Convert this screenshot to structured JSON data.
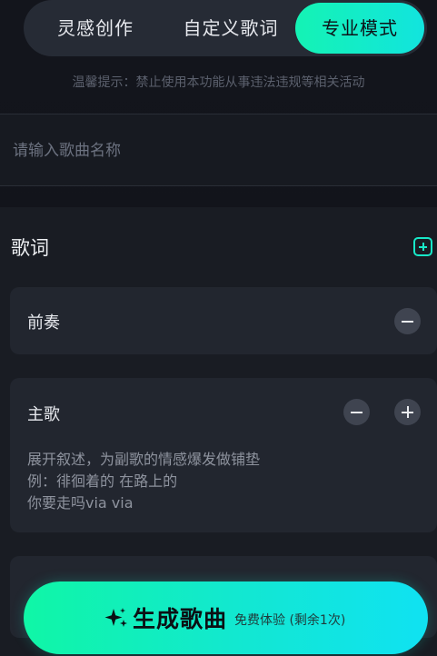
{
  "tabs": [
    {
      "label": "灵感创作",
      "active": false
    },
    {
      "label": "自定义歌词",
      "active": false
    },
    {
      "label": "专业模式",
      "active": true
    }
  ],
  "notice": "温馨提示：禁止使用本功能从事违法违规等相关活动",
  "song_name": {
    "value": "",
    "placeholder": "请输入歌曲名称"
  },
  "lyrics": {
    "title": "歌词",
    "sections": [
      {
        "title": "前奏"
      },
      {
        "title": "主歌",
        "hint_lines": [
          "展开叙述，为副歌的情感爆发做铺垫",
          "例：徘徊着的 在路上的",
          "你要走吗via via"
        ]
      }
    ]
  },
  "generate": {
    "label": "生成歌曲",
    "sub": "免费体验 (剩余1次)"
  },
  "colors": {
    "accent": "#14f0c0",
    "background": "#12141b",
    "card": "#22262f"
  }
}
